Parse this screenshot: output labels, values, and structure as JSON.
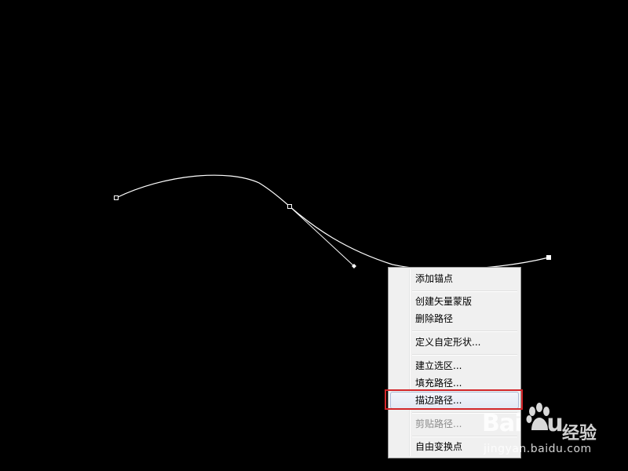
{
  "canvas": {
    "background": "#000000",
    "path_color": "#ffffff"
  },
  "context_menu": {
    "items": [
      {
        "label": "添加锚点",
        "state": "normal"
      },
      {
        "label": "创建矢量蒙版",
        "state": "normal"
      },
      {
        "label": "删除路径",
        "state": "normal"
      },
      {
        "label": "定义自定形状...",
        "state": "normal"
      },
      {
        "label": "建立选区...",
        "state": "normal"
      },
      {
        "label": "填充路径...",
        "state": "normal"
      },
      {
        "label": "描边路径...",
        "state": "highlighted"
      },
      {
        "label": "剪贴路径...",
        "state": "disabled"
      },
      {
        "label": "自由变换点",
        "state": "normal"
      }
    ],
    "highlight_box_color": "#d2262a"
  },
  "watermark": {
    "brand": "Bai",
    "brand_suffix": "u",
    "product": "经验",
    "url": "jingyan.baidu.com"
  }
}
